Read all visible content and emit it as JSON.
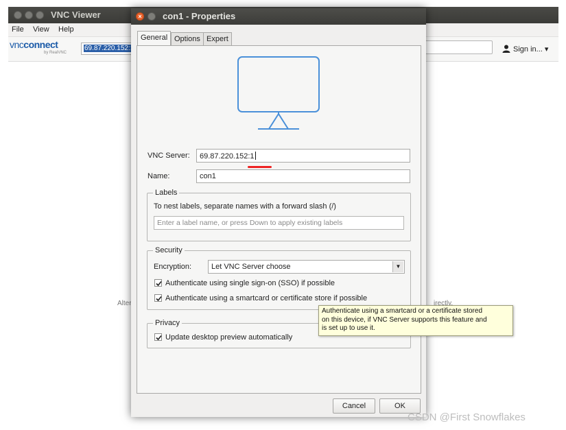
{
  "main_window": {
    "title": "VNC Viewer",
    "menu": {
      "file": "File",
      "view": "View",
      "help": "Help"
    },
    "logo": {
      "main_light": "vnc",
      "main_bold": "connect",
      "sub": "by RealVNC"
    },
    "address_value": "69.87.220.152:1",
    "sign_in_label": "Sign in...",
    "sign_in_arrow": "▾",
    "alt_text_left": "Alter",
    "alt_text_right": "irectly."
  },
  "dialog": {
    "title": "con1 - Properties",
    "close_glyph": "×",
    "tabs": [
      {
        "label": "General",
        "active": true
      },
      {
        "label": "Options",
        "active": false
      },
      {
        "label": "Expert",
        "active": false
      }
    ],
    "vnc_server": {
      "label": "VNC Server:",
      "value": "69.87.220.152:1"
    },
    "name": {
      "label": "Name:",
      "value": "con1"
    },
    "labels_group": {
      "legend": "Labels",
      "hint": "To nest labels, separate names with a forward slash (/)",
      "placeholder": "Enter a label name, or press Down to apply existing labels"
    },
    "security_group": {
      "legend": "Security",
      "encryption_label": "Encryption:",
      "encryption_value": "Let VNC Server choose",
      "dropdown_arrow": "▼",
      "sso_label": "Authenticate using single sign-on (SSO) if possible",
      "sso_checked": true,
      "smartcard_label": "Authenticate using a smartcard or certificate store if possible",
      "smartcard_checked": true
    },
    "privacy_group": {
      "legend": "Privacy",
      "preview_label": "Update desktop preview automatically",
      "preview_checked": true
    },
    "buttons": {
      "cancel": "Cancel",
      "ok": "OK"
    }
  },
  "tooltip": {
    "line1": "Authenticate using a smartcard or a certificate stored",
    "line2": "on this device, if VNC Server supports this feature and",
    "line3": "is set up to use it."
  },
  "watermark": "CSDN @First Snowflakes",
  "colors": {
    "accent_blue": "#4a90d9",
    "selection_blue": "#2b5fa8",
    "close_orange": "#e8622c",
    "tooltip_bg": "#ffffdc"
  }
}
